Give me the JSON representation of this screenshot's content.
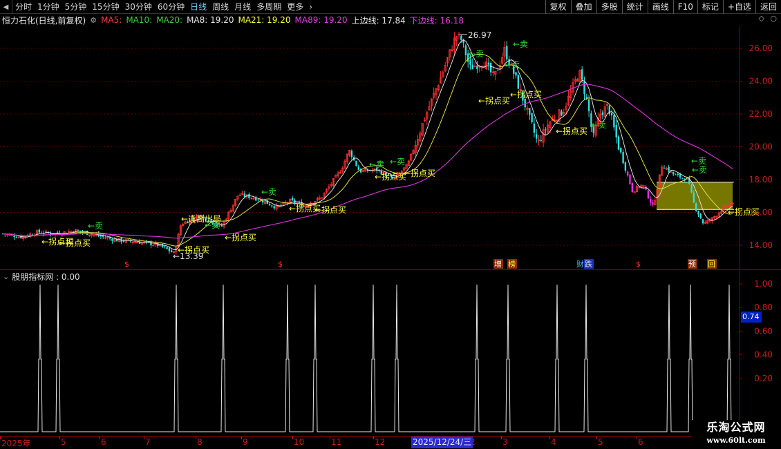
{
  "toolbar": {
    "periods": [
      "分时",
      "1分钟",
      "5分钟",
      "15分钟",
      "30分钟",
      "60分钟",
      "日线",
      "周线",
      "月线",
      "多周期",
      "更多"
    ],
    "active_period": "日线",
    "buttons": [
      "复权",
      "叠加",
      "多股",
      "统计",
      "画线",
      "F10",
      "标记",
      "+自选",
      "返回"
    ]
  },
  "ma_bar": {
    "title": "恒力石化(日线,前复权)",
    "ma5": "MA5:",
    "ma10": "MA10:",
    "ma20": "MA20:",
    "ma8": "MA8: 19.20",
    "ma21": "MA21: 19.20",
    "ma89": "MA89: 19.20",
    "upper": "上边线: 17.84",
    "lower": "下边线: 16.18",
    "colors": {
      "ma5": "#ff4040",
      "ma10": "#40d040",
      "ma20": "#40d040",
      "ma8": "#e8e8e8",
      "ma21": "#ffff40",
      "ma89": "#e040e0",
      "upper": "#e8e8e8",
      "lower": "#e040e0"
    }
  },
  "chart_data": {
    "type": "candlestick",
    "ylim": [
      13.2,
      27.3
    ],
    "y_ticks": [
      "26.00",
      "24.00",
      "22.00",
      "20.00",
      "18.00",
      "16.00",
      "14.00"
    ],
    "high_label": "26.97",
    "low_label": "13.39",
    "annotations": {
      "sell": "←卖",
      "buy": "←拐点买",
      "high_out": "←逢高出局"
    },
    "event_tags": [
      "$",
      "$",
      "增",
      "榜",
      "财",
      "跌",
      "$",
      "预",
      "回"
    ],
    "colors": {
      "up": "#ff3030",
      "down": "#30e0e0",
      "ma_white": "#e0e0e0",
      "ma_yellow": "#e0e040",
      "ma_purple": "#d030d0",
      "box": "#8c8c00"
    }
  },
  "indicator": {
    "icon": "collapse-icon",
    "title": "股朋指标网 : 0.00",
    "value_tag": "0.74",
    "y_ticks": [
      "1.00",
      "0.80",
      "0.60",
      "0.40",
      "0.20"
    ]
  },
  "x_axis": {
    "labels": [
      "2025年",
      "5",
      "6",
      "7",
      "8",
      "9",
      "10",
      "11",
      "12",
      "2",
      "3",
      "4",
      "5",
      "6"
    ],
    "highlight": "2025/12/24/三"
  },
  "watermark": {
    "title": "乐淘公式网",
    "url": "www.60lt.com"
  }
}
